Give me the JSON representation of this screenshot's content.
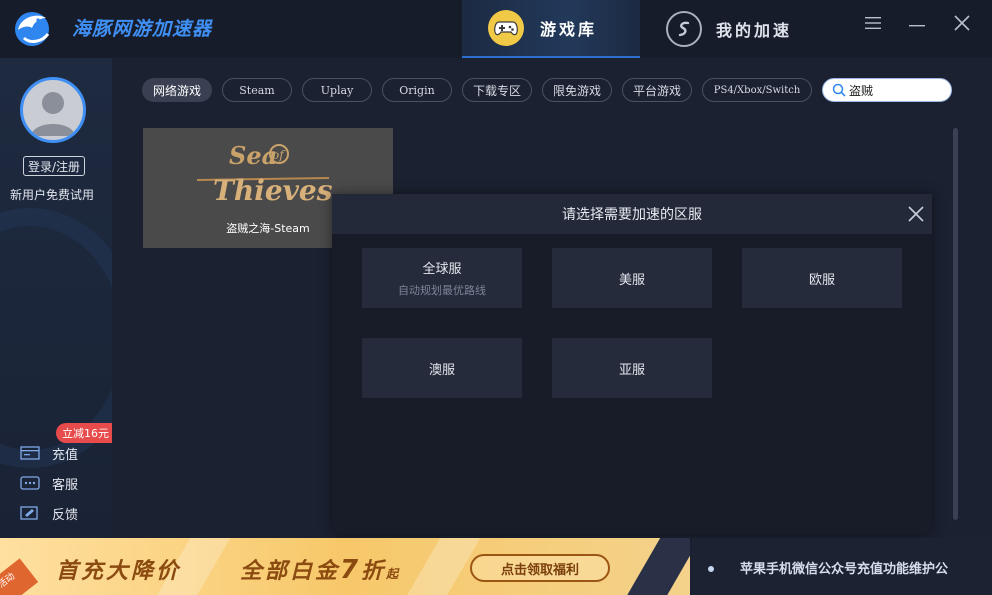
{
  "app": {
    "brand": "海豚网游加速器"
  },
  "tabs": [
    {
      "label": "游戏库",
      "icon": "gamepad-icon",
      "active": true
    },
    {
      "label": "我的加速",
      "icon": "speed-swirl-icon",
      "active": false
    }
  ],
  "window_controls": [
    "menu-icon",
    "minimize-icon",
    "close-icon"
  ],
  "sidebar": {
    "login_label": "登录/注册",
    "trial_text": "新用户免费试用",
    "promo_badge": "立减16元",
    "items": [
      {
        "label": "充值",
        "icon": "wallet-icon"
      },
      {
        "label": "客服",
        "icon": "chat-icon"
      },
      {
        "label": "反馈",
        "icon": "feedback-icon"
      }
    ]
  },
  "filters": {
    "chips": [
      {
        "label": "网络游戏",
        "active": true
      },
      {
        "label": "Steam",
        "active": false
      },
      {
        "label": "Uplay",
        "active": false
      },
      {
        "label": "Origin",
        "active": false
      },
      {
        "label": "下载专区",
        "active": false
      },
      {
        "label": "限免游戏",
        "active": false
      },
      {
        "label": "平台游戏",
        "active": false
      },
      {
        "label": "PS4/Xbox/Switch",
        "active": false
      }
    ],
    "search_value": "盗贼"
  },
  "games": [
    {
      "title": "盗贼之海-Steam",
      "logo_text": [
        "Sea",
        "of",
        "Thieves"
      ]
    }
  ],
  "modal": {
    "title": "请选择需要加速的区服",
    "regions": [
      {
        "label": "全球服",
        "sub": "自动规划最优路线"
      },
      {
        "label": "美服",
        "sub": ""
      },
      {
        "label": "欧服",
        "sub": ""
      },
      {
        "label": "澳服",
        "sub": ""
      },
      {
        "label": "亚服",
        "sub": ""
      }
    ]
  },
  "banner": {
    "corner_tag": "活动",
    "headline_1": "首充大降价",
    "headline_2_prefix": "全部白金",
    "headline_2_number": "7",
    "headline_2_suffix": "折",
    "headline_2_tail": "起",
    "cta": "点击领取福利"
  },
  "notice": {
    "text": "苹果手机微信公众号充值功能维护公"
  },
  "colors": {
    "accent_blue": "#3f8ff4",
    "tab_icon_yellow": "#f0c946",
    "promo_red": "#e84b4b",
    "banner_gold": "#f7c86a"
  }
}
